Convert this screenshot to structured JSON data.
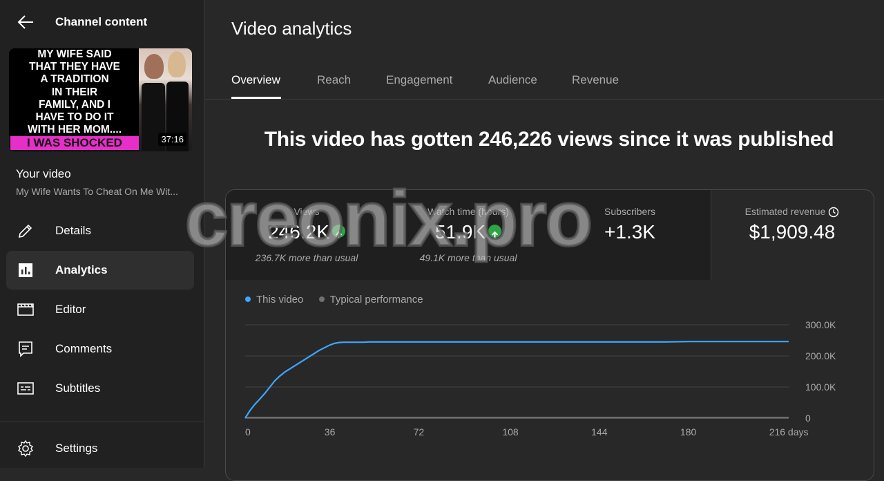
{
  "sidebar": {
    "title": "Channel content",
    "thumbnail": {
      "text": "MY WIFE SAID\nTHAT THEY HAVE\nA TRADITION\nIN THEIR\nFAMILY, AND I\nHAVE TO DO IT\nWITH HER MOM....",
      "highlight": "I WAS SHOCKED",
      "duration": "37:16"
    },
    "your_video_label": "Your video",
    "video_title": "My Wife Wants To Cheat On Me Wit...",
    "items": [
      {
        "label": "Details",
        "icon": "pencil-icon"
      },
      {
        "label": "Analytics",
        "icon": "analytics-icon",
        "active": true
      },
      {
        "label": "Editor",
        "icon": "clapperboard-icon"
      },
      {
        "label": "Comments",
        "icon": "comment-icon"
      },
      {
        "label": "Subtitles",
        "icon": "subtitles-icon"
      }
    ],
    "settings_label": "Settings"
  },
  "main": {
    "title": "Video analytics",
    "tabs": [
      {
        "label": "Overview"
      },
      {
        "label": "Reach"
      },
      {
        "label": "Engagement"
      },
      {
        "label": "Audience"
      },
      {
        "label": "Revenue"
      }
    ],
    "headline": "This video has gotten 246,226 views since it was published",
    "metrics": [
      {
        "label": "Views",
        "value": "246.2K",
        "sub": "236.7K more than usual",
        "trend": "up"
      },
      {
        "label": "Watch time (hours)",
        "value": "51.9K",
        "sub": "49.1K more than usual",
        "trend": "up"
      },
      {
        "label": "Subscribers",
        "value": "+1.3K",
        "sub": ""
      },
      {
        "label": "Estimated revenue",
        "value": "$1,909.48",
        "sub": ""
      }
    ]
  },
  "watermark": "creonix.pro",
  "colors": {
    "this_video": "#3ea6ff",
    "typical": "#717171",
    "up_badge": "#2ba640"
  },
  "chart_data": {
    "type": "line",
    "series": [
      {
        "name": "This video",
        "x": [
          0,
          2,
          4,
          6,
          8,
          10,
          12,
          14,
          16,
          18,
          20,
          22,
          24,
          26,
          28,
          30,
          32,
          34,
          36,
          38,
          40,
          42,
          44,
          46,
          48,
          50,
          60,
          80,
          100,
          120,
          140,
          160,
          170,
          180,
          200,
          220
        ],
        "y": [
          0,
          25000,
          45000,
          62000,
          80000,
          100000,
          120000,
          135000,
          148000,
          158000,
          168000,
          178000,
          188000,
          198000,
          208000,
          218000,
          226000,
          234000,
          240000,
          243000,
          244000,
          244000,
          244000,
          244000,
          244000,
          245000,
          245000,
          245000,
          245000,
          245000,
          245000,
          245000,
          245000,
          246200,
          246200,
          246200
        ]
      },
      {
        "name": "Typical performance",
        "x": [
          0,
          220
        ],
        "y": [
          2000,
          2000
        ]
      }
    ],
    "xticks": [
      "0",
      "36",
      "72",
      "108",
      "144",
      "180",
      "216 days"
    ],
    "yticks": [
      "0",
      "100.0K",
      "200.0K",
      "300.0K"
    ],
    "xlim": [
      0,
      220
    ],
    "ylim": [
      0,
      300000
    ],
    "grid": true,
    "legend": "top-left"
  }
}
